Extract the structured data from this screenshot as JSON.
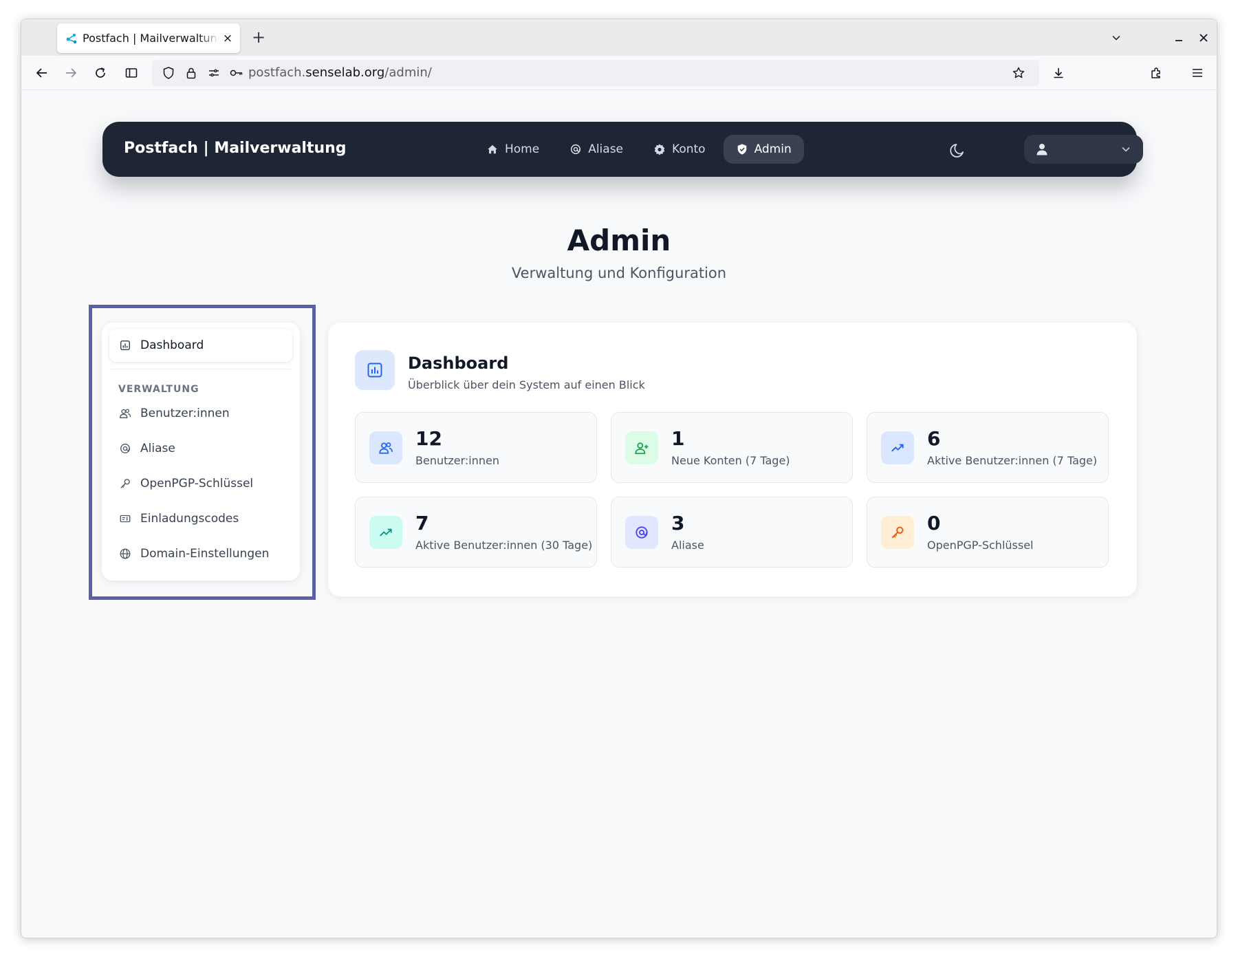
{
  "browser": {
    "tab_title": "Postfach | Mailverwaltung",
    "tab_close": "×",
    "new_tab": "+",
    "url_prefix": "postfach.",
    "url_host": "senselab.org",
    "url_path": "/admin/"
  },
  "nav": {
    "brand": "Postfach | Mailverwaltung",
    "links": [
      {
        "label": "Home",
        "icon": "home-icon",
        "active": false
      },
      {
        "label": "Aliase",
        "icon": "at-icon",
        "active": false
      },
      {
        "label": "Konto",
        "icon": "gear-icon",
        "active": false
      },
      {
        "label": "Admin",
        "icon": "shield-icon",
        "active": true
      }
    ]
  },
  "hero": {
    "title": "Admin",
    "subtitle": "Verwaltung und Konfiguration"
  },
  "sidebar": {
    "active_item": "Dashboard",
    "section_label": "VERWALTUNG",
    "items": [
      {
        "label": "Benutzer:innen",
        "icon": "users-icon"
      },
      {
        "label": "Aliase",
        "icon": "at-icon"
      },
      {
        "label": "OpenPGP-Schlüssel",
        "icon": "key-icon"
      },
      {
        "label": "Einladungscodes",
        "icon": "ticket-icon"
      },
      {
        "label": "Domain-Einstellungen",
        "icon": "globe-icon"
      }
    ]
  },
  "dashboard": {
    "title": "Dashboard",
    "subtitle": "Überblick über dein System auf einen Blick",
    "stats": [
      {
        "value": "12",
        "label": "Benutzer:innen",
        "icon": "users-icon",
        "color": "#2563eb",
        "bg": "#dbe7fe"
      },
      {
        "value": "1",
        "label": "Neue Konten (7 Tage)",
        "icon": "user-plus-icon",
        "color": "#16a34a",
        "bg": "#dcfce7"
      },
      {
        "value": "6",
        "label": "Aktive Benutzer:innen (7 Tage)",
        "icon": "trend-up-icon",
        "color": "#2563eb",
        "bg": "#dbe7fe"
      },
      {
        "value": "7",
        "label": "Aktive Benutzer:innen (30 Tage)",
        "icon": "trend-up-icon",
        "color": "#0d9488",
        "bg": "#ccfbf1"
      },
      {
        "value": "3",
        "label": "Aliase",
        "icon": "at-icon",
        "color": "#4f46e5",
        "bg": "#e0e7ff"
      },
      {
        "value": "0",
        "label": "OpenPGP-Schlüssel",
        "icon": "key-icon",
        "color": "#ea580c",
        "bg": "#ffedd5"
      }
    ]
  }
}
